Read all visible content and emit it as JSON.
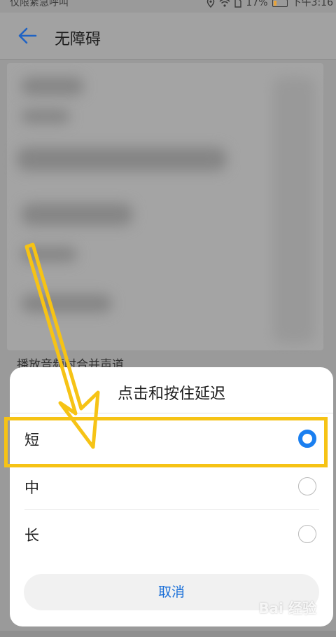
{
  "statusbar": {
    "carrier_text": "仅限紧急呼叫",
    "battery": "17%",
    "time": "下午3:16"
  },
  "appbar": {
    "title": "无障碍",
    "back_icon": "arrow-left-icon"
  },
  "background": {
    "partial_label": "播放音频时合并声道"
  },
  "dialog": {
    "title": "点击和按住延迟",
    "options": [
      {
        "label": "短",
        "selected": true
      },
      {
        "label": "中",
        "selected": false
      },
      {
        "label": "长",
        "selected": false
      }
    ],
    "cancel_label": "取消",
    "accent_color": "#1a7ff0"
  },
  "annotation": {
    "highlight_color": "#f6c315",
    "arrow_color": "#f6c315"
  },
  "watermark": {
    "text": "Bai 经验"
  }
}
